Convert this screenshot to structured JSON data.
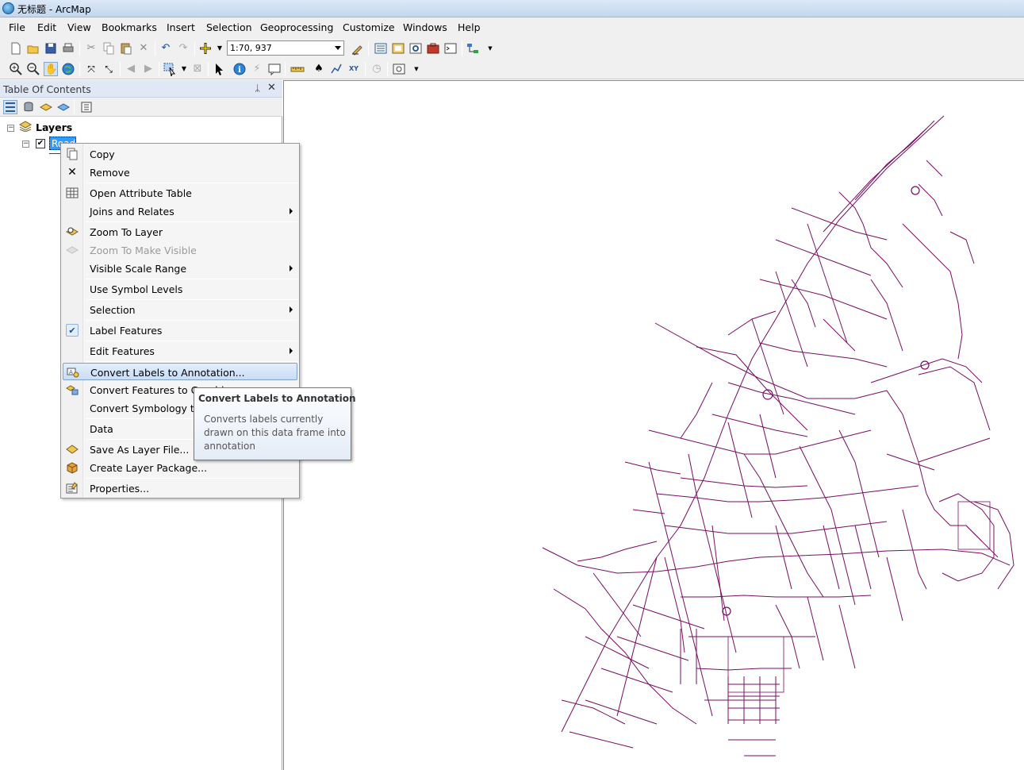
{
  "window": {
    "title": "无标题 - ArcMap"
  },
  "menubar": [
    "File",
    "Edit",
    "View",
    "Bookmarks",
    "Insert",
    "Selection",
    "Geoprocessing",
    "Customize",
    "Windows",
    "Help"
  ],
  "toolbar": {
    "scale": "1:70, 937"
  },
  "toc": {
    "title": "Table Of Contents",
    "pin_glyph": "ᛦ",
    "close_glyph": "✕",
    "data_frame": "Layers",
    "layer_name": "Roads"
  },
  "context_menu": {
    "items": [
      {
        "label": "Copy",
        "icon": "copy-icon"
      },
      {
        "label": "Remove",
        "icon": "remove-icon"
      },
      {
        "label": "Open Attribute Table",
        "icon": "table-icon"
      },
      {
        "label": "Joins and Relates",
        "icon": "",
        "submenu": true
      },
      {
        "label": "Zoom To Layer",
        "icon": "zoom-layer-icon"
      },
      {
        "label": "Zoom To Make Visible",
        "icon": "zoom-visible-icon",
        "disabled": true
      },
      {
        "label": "Visible Scale Range",
        "icon": "",
        "submenu": true
      },
      {
        "label": "Use Symbol Levels",
        "icon": ""
      },
      {
        "label": "Selection",
        "icon": "",
        "submenu": true
      },
      {
        "label": "Label Features",
        "icon": "check-icon",
        "checked": true
      },
      {
        "label": "Edit Features",
        "icon": "",
        "submenu": true
      },
      {
        "label": "Convert Labels to Annotation...",
        "icon": "convert-labels-icon",
        "hover": true
      },
      {
        "label": "Convert Features to Graphics...",
        "icon": "convert-features-icon"
      },
      {
        "label": "Convert Symbology to Representation...",
        "icon": ""
      },
      {
        "label": "Data",
        "icon": "",
        "submenu": true
      },
      {
        "label": "Save As Layer File...",
        "icon": "layer-file-icon"
      },
      {
        "label": "Create Layer Package...",
        "icon": "layer-package-icon"
      },
      {
        "label": "Properties...",
        "icon": "properties-icon"
      }
    ]
  },
  "tooltip": {
    "title": "Convert Labels to Annotation",
    "body": "Converts labels currently drawn on this data frame into annotation"
  },
  "map": {
    "line_color": "#7a0d63"
  }
}
